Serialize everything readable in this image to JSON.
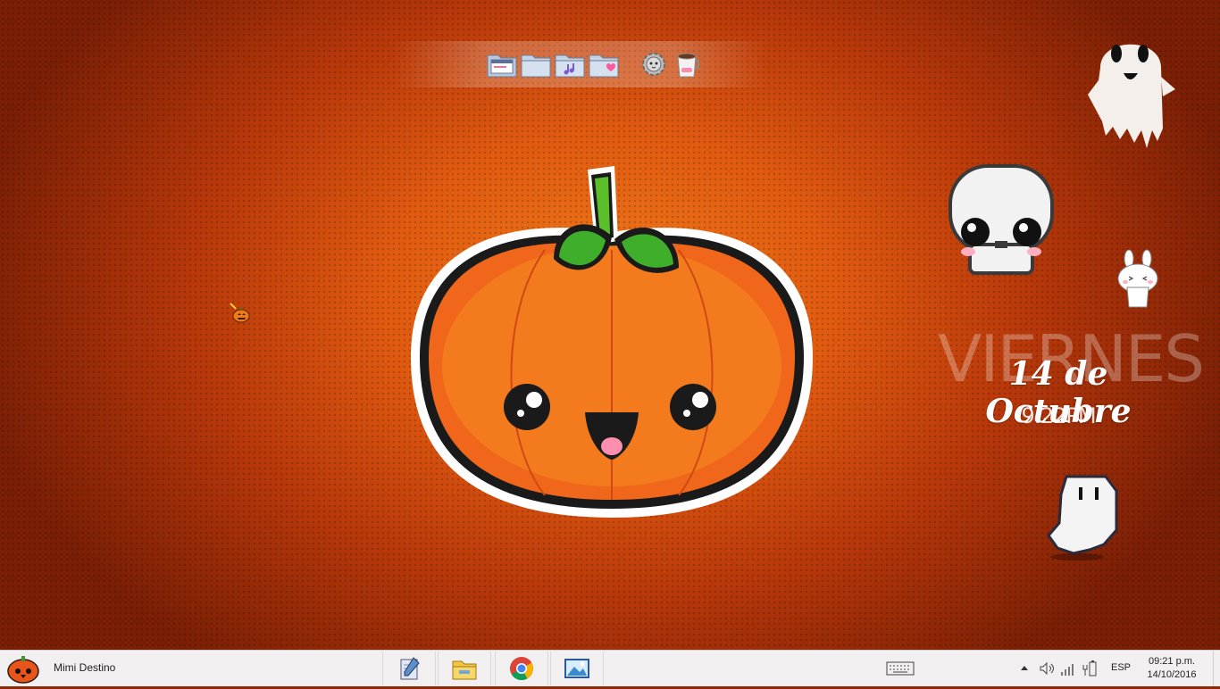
{
  "desktop": {
    "dock_items": [
      {
        "name": "window-folder-icon"
      },
      {
        "name": "blank-folder-icon"
      },
      {
        "name": "music-folder-icon"
      },
      {
        "name": "heart-folder-icon"
      },
      {
        "name": "settings-gear-icon"
      },
      {
        "name": "coffee-cup-icon"
      }
    ],
    "date_widget": {
      "weekday": "VIERNES",
      "date": "14 de Octubre",
      "time": "9:22PM"
    }
  },
  "taskbar": {
    "user": "Mimi Destino",
    "apps": [
      {
        "name": "notepad-app-icon"
      },
      {
        "name": "file-explorer-icon"
      },
      {
        "name": "chrome-icon"
      },
      {
        "name": "photos-app-icon"
      }
    ],
    "language": "ESP",
    "clock_time": "09:21 p.m.",
    "clock_date": "14/10/2016"
  },
  "colors": {
    "wallpaper_center": "#f07a1a",
    "wallpaper_edge": "#7a1f05",
    "pumpkin": "#f0661a",
    "leaf": "#3fae2a",
    "taskbar": "#f1eff0"
  }
}
